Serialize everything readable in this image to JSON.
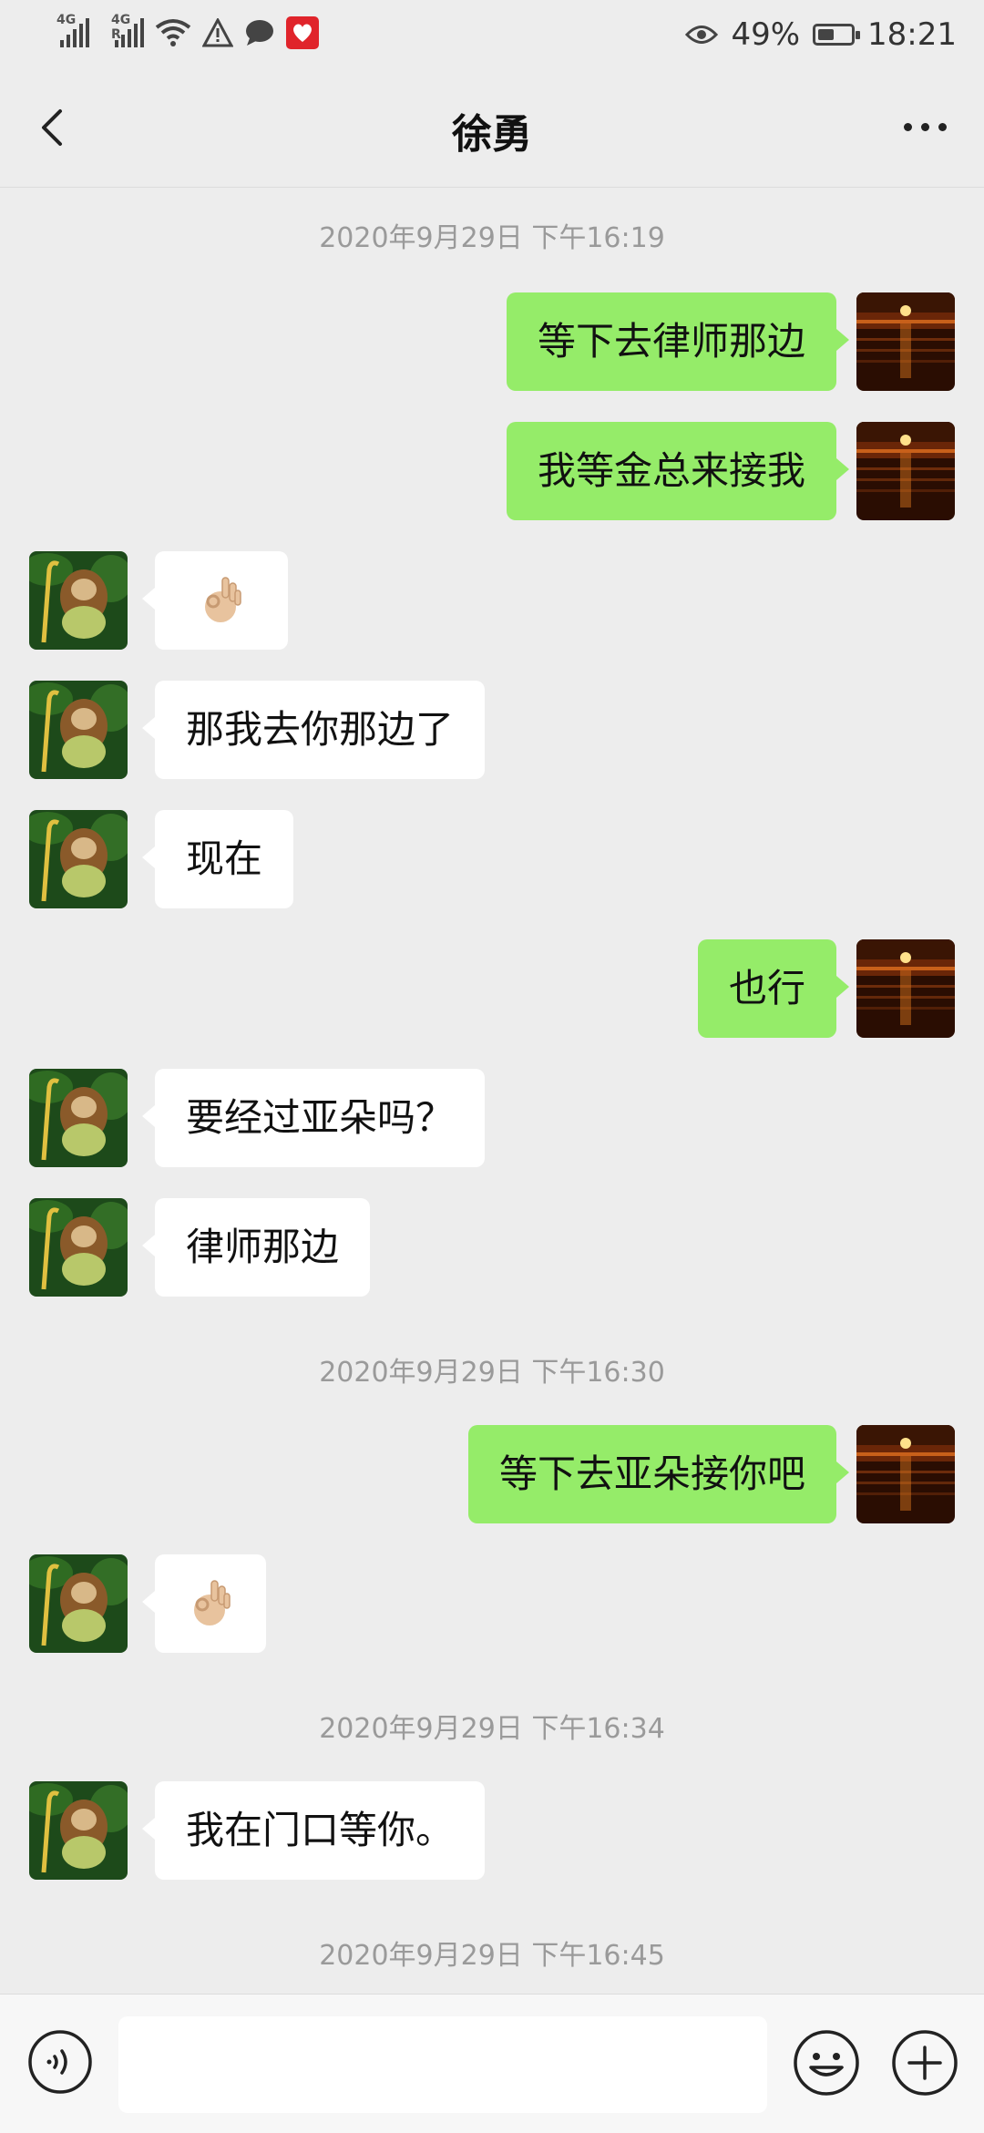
{
  "status_bar": {
    "net1": "4G",
    "net2": "4G R",
    "battery_percent": "49%",
    "battery_level": 0.49,
    "time": "18:21",
    "icons": [
      "signal-icon",
      "signal-icon",
      "wifi-icon",
      "warning-icon",
      "message-icon",
      "app-notification-icon",
      "eye-icon",
      "battery-icon"
    ]
  },
  "header": {
    "title": "徐勇",
    "back_icon": "chevron-left-icon",
    "more_icon": "more-dots-icon"
  },
  "messages": [
    {
      "type": "timestamp",
      "text": "2020年9月29日 下午16:19"
    },
    {
      "type": "out",
      "text": "等下去律师那边"
    },
    {
      "type": "out",
      "text": "我等金总来接我"
    },
    {
      "type": "in",
      "text": "",
      "emoji": "ok-hand-emoji"
    },
    {
      "type": "in",
      "text": "那我去你那边了"
    },
    {
      "type": "in",
      "text": "现在"
    },
    {
      "type": "out",
      "text": "也行"
    },
    {
      "type": "in",
      "text": "要经过亚朵吗？"
    },
    {
      "type": "in",
      "text": "律师那边"
    },
    {
      "type": "timestamp",
      "text": "2020年9月29日 下午16:30"
    },
    {
      "type": "out",
      "text": "等下去亚朵接你吧"
    },
    {
      "type": "in",
      "text": "",
      "emoji": "ok-hand-emoji"
    },
    {
      "type": "timestamp",
      "text": "2020年9月29日 下午16:34"
    },
    {
      "type": "in",
      "text": "我在门口等你。"
    },
    {
      "type": "timestamp",
      "text": "2020年9月29日 下午16:45"
    }
  ],
  "input_bar": {
    "value": "",
    "voice_icon": "voice-icon",
    "emoji_icon": "emoji-icon",
    "plus_icon": "plus-icon"
  },
  "colors": {
    "background": "#ededed",
    "outgoing_bubble": "#95ec69",
    "incoming_bubble": "#ffffff",
    "timestamp_text": "#9a9a9a"
  }
}
